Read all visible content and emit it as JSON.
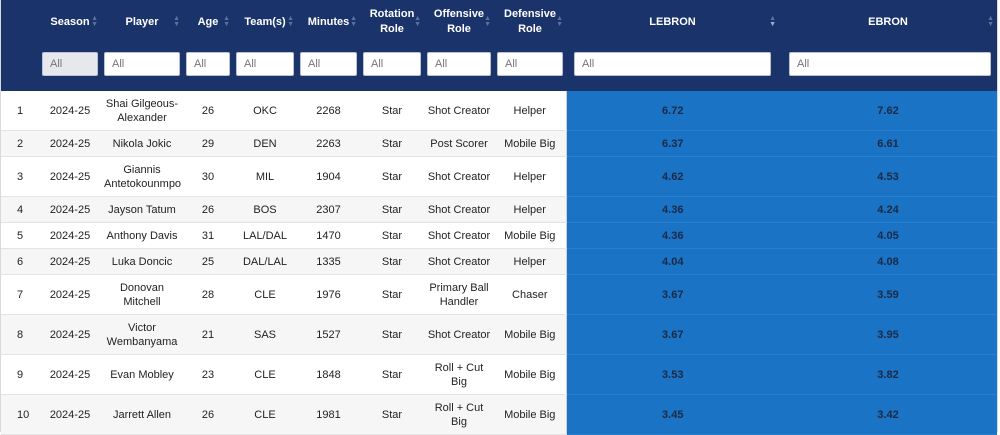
{
  "headers": {
    "season": "Season",
    "player": "Player",
    "age": "Age",
    "teams": "Team(s)",
    "minutes": "Minutes",
    "rotation_role_1": "Rotation",
    "rotation_role_2": "Role",
    "offensive_role_1": "Offensive",
    "offensive_role_2": "Role",
    "defensive_role_1": "Defensive",
    "defensive_role_2": "Role",
    "lebron": "LEBRON",
    "ebron": "EBRON"
  },
  "filters": {
    "season": "All",
    "player": "All",
    "age": "All",
    "teams": "All",
    "minutes": "All",
    "rotation_role": "All",
    "offensive_role": "All",
    "defensive_role": "All",
    "lebron": "All",
    "ebron": "All"
  },
  "rows": [
    {
      "idx": "1",
      "season": "2024-25",
      "player_1": "Shai Gilgeous-",
      "player_2": "Alexander",
      "age": "26",
      "teams": "OKC",
      "minutes": "2268",
      "rotation": "Star",
      "offense_1": "Shot Creator",
      "offense_2": "",
      "defense": "Helper",
      "lebron": "6.72",
      "ebron": "7.62"
    },
    {
      "idx": "2",
      "season": "2024-25",
      "player_1": "Nikola Jokic",
      "player_2": "",
      "age": "29",
      "teams": "DEN",
      "minutes": "2263",
      "rotation": "Star",
      "offense_1": "Post Scorer",
      "offense_2": "",
      "defense": "Mobile Big",
      "lebron": "6.37",
      "ebron": "6.61"
    },
    {
      "idx": "3",
      "season": "2024-25",
      "player_1": "Giannis",
      "player_2": "Antetokounmpo",
      "age": "30",
      "teams": "MIL",
      "minutes": "1904",
      "rotation": "Star",
      "offense_1": "Shot Creator",
      "offense_2": "",
      "defense": "Helper",
      "lebron": "4.62",
      "ebron": "4.53"
    },
    {
      "idx": "4",
      "season": "2024-25",
      "player_1": "Jayson Tatum",
      "player_2": "",
      "age": "26",
      "teams": "BOS",
      "minutes": "2307",
      "rotation": "Star",
      "offense_1": "Shot Creator",
      "offense_2": "",
      "defense": "Helper",
      "lebron": "4.36",
      "ebron": "4.24"
    },
    {
      "idx": "5",
      "season": "2024-25",
      "player_1": "Anthony Davis",
      "player_2": "",
      "age": "31",
      "teams": "LAL/DAL",
      "minutes": "1470",
      "rotation": "Star",
      "offense_1": "Shot Creator",
      "offense_2": "",
      "defense": "Mobile Big",
      "lebron": "4.36",
      "ebron": "4.05"
    },
    {
      "idx": "6",
      "season": "2024-25",
      "player_1": "Luka Doncic",
      "player_2": "",
      "age": "25",
      "teams": "DAL/LAL",
      "minutes": "1335",
      "rotation": "Star",
      "offense_1": "Shot Creator",
      "offense_2": "",
      "defense": "Helper",
      "lebron": "4.04",
      "ebron": "4.08"
    },
    {
      "idx": "7",
      "season": "2024-25",
      "player_1": "Donovan",
      "player_2": "Mitchell",
      "age": "28",
      "teams": "CLE",
      "minutes": "1976",
      "rotation": "Star",
      "offense_1": "Primary Ball",
      "offense_2": "Handler",
      "defense": "Chaser",
      "lebron": "3.67",
      "ebron": "3.59"
    },
    {
      "idx": "8",
      "season": "2024-25",
      "player_1": "Victor",
      "player_2": "Wembanyama",
      "age": "21",
      "teams": "SAS",
      "minutes": "1527",
      "rotation": "Star",
      "offense_1": "Shot Creator",
      "offense_2": "",
      "defense": "Mobile Big",
      "lebron": "3.67",
      "ebron": "3.95"
    },
    {
      "idx": "9",
      "season": "2024-25",
      "player_1": "Evan Mobley",
      "player_2": "",
      "age": "23",
      "teams": "CLE",
      "minutes": "1848",
      "rotation": "Star",
      "offense_1": "Roll + Cut",
      "offense_2": "Big",
      "defense": "Mobile Big",
      "lebron": "3.53",
      "ebron": "3.82"
    },
    {
      "idx": "10",
      "season": "2024-25",
      "player_1": "Jarrett Allen",
      "player_2": "",
      "age": "26",
      "teams": "CLE",
      "minutes": "1981",
      "rotation": "Star",
      "offense_1": "Roll + Cut",
      "offense_2": "Big",
      "defense": "Mobile Big",
      "lebron": "3.45",
      "ebron": "3.42"
    }
  ],
  "colors": {
    "header_bg": "#1b336b",
    "metric_cell_bg": "#1a73c4"
  },
  "icons": {
    "sort": "sort-arrows-icon"
  }
}
